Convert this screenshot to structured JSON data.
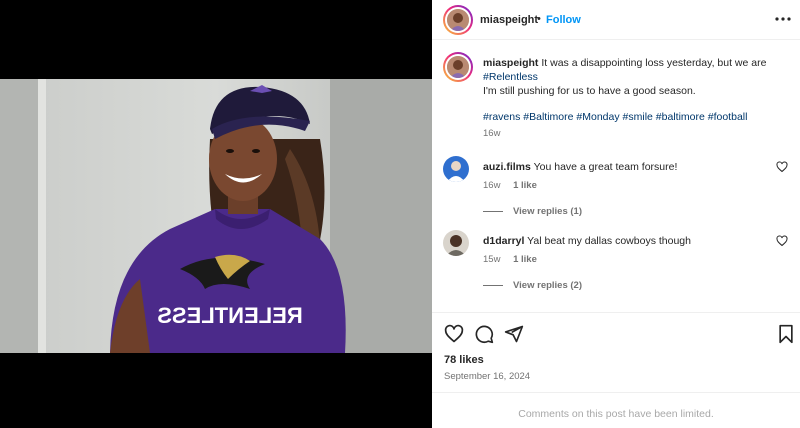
{
  "post": {
    "username": "miaspeight",
    "separator": "•",
    "follow_label": "Follow",
    "caption_text": " It was a disappointing loss yesterday, but we are ",
    "caption_tag": "#Relentless",
    "caption_line2": "I'm still pushing for us to have a good season.",
    "hashtags": [
      "#ravens",
      "#Baltimore",
      "#Monday",
      "#smile",
      "#baltimore",
      "#football"
    ],
    "caption_age": "16w",
    "shirt_text": "RELENTLESS"
  },
  "comments": [
    {
      "username": "auzi.films",
      "text": " You have a great team forsure!",
      "age": "16w",
      "likes": "1 like",
      "replies": "View replies (1)"
    },
    {
      "username": "d1darryl",
      "text": " Yal beat my dallas cowboys though",
      "age": "15w",
      "likes": "1 like",
      "replies": "View replies (2)"
    }
  ],
  "actions": {
    "like_count": "78 likes",
    "date": "September 16, 2024",
    "icons": [
      "heart-icon",
      "comment-icon",
      "share-icon",
      "bookmark-icon"
    ]
  },
  "footer": {
    "notice": "Comments on this post have been limited."
  },
  "colors": {
    "link": "#0095f6",
    "hashtag": "#00376b",
    "muted": "#737373",
    "ravens_purple": "#4b2a8a"
  }
}
